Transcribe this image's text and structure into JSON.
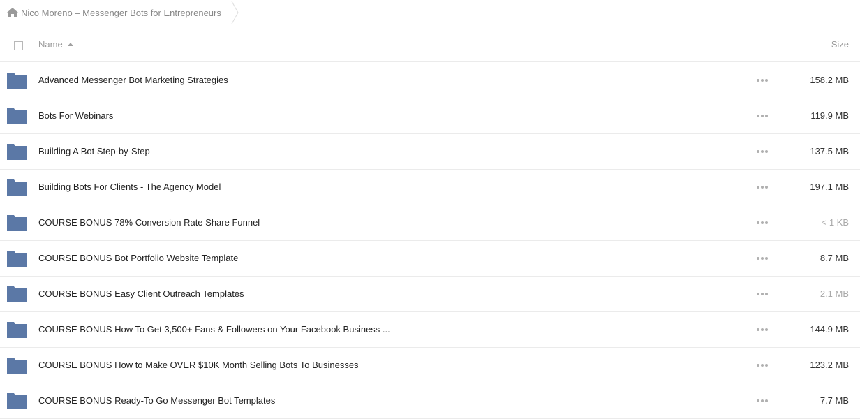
{
  "breadcrumb": {
    "home_icon": "home-icon",
    "label": "Nico Moreno – Messenger Bots for Entrepreneurs"
  },
  "table": {
    "columns": {
      "name": "Name",
      "size": "Size"
    },
    "sort": {
      "column": "name",
      "direction": "ascending",
      "icon": "sort-ascending-icon"
    },
    "folder_color": "#5b78a6",
    "rows": [
      {
        "name": "Advanced Messenger Bot Marketing Strategies",
        "size": "158.2 MB",
        "icon": "folder-icon"
      },
      {
        "name": "Bots For Webinars",
        "size": "119.9 MB",
        "icon": "folder-icon"
      },
      {
        "name": "Building A Bot Step-by-Step",
        "size": "137.5 MB",
        "icon": "folder-icon"
      },
      {
        "name": "Building Bots For Clients - The Agency Model",
        "size": "197.1 MB",
        "icon": "folder-icon"
      },
      {
        "name": "COURSE BONUS 78% Conversion Rate Share Funnel",
        "size": "< 1 KB",
        "icon": "folder-icon"
      },
      {
        "name": "COURSE BONUS Bot Portfolio Website Template",
        "size": "8.7 MB",
        "icon": "folder-icon"
      },
      {
        "name": "COURSE BONUS Easy Client Outreach Templates",
        "size": "2.1 MB",
        "icon": "folder-icon"
      },
      {
        "name": "COURSE BONUS How To Get 3,500+ Fans & Followers on Your Facebook Business ...",
        "size": "144.9 MB",
        "icon": "folder-icon"
      },
      {
        "name": "COURSE BONUS How to Make OVER $10K Month Selling Bots To Businesses",
        "size": "123.2 MB",
        "icon": "folder-icon"
      },
      {
        "name": "COURSE BONUS Ready-To Go Messenger Bot Templates",
        "size": "7.7 MB",
        "icon": "folder-icon"
      }
    ]
  }
}
